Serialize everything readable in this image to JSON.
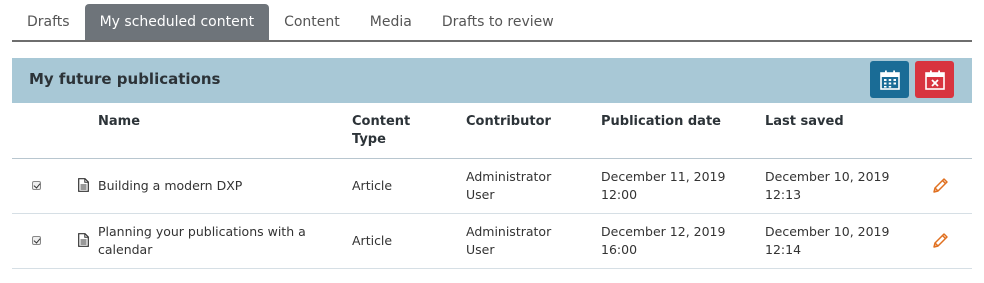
{
  "tabs": [
    {
      "label": "Drafts"
    },
    {
      "label": "My scheduled content"
    },
    {
      "label": "Content"
    },
    {
      "label": "Media"
    },
    {
      "label": "Drafts to review"
    }
  ],
  "panel": {
    "title": "My future publications",
    "calendar_icon": "calendar-icon",
    "unschedule_icon": "calendar-remove-icon",
    "colors": {
      "header_bg": "#a8c8d6",
      "calendar_btn": "#1a6c96",
      "unschedule_btn": "#d8343f",
      "edit_icon": "#e07020"
    }
  },
  "table": {
    "headers": {
      "name": "Name",
      "content_type_1": "Content",
      "content_type_2": "Type",
      "contributor": "Contributor",
      "publication_date": "Publication date",
      "last_saved": "Last saved"
    },
    "rows": [
      {
        "checked": true,
        "name_1": "Building a modern DXP",
        "name_2": "",
        "content_type": "Article",
        "contributor_1": "Administrator",
        "contributor_2": "User",
        "publication_date_1": "December 11, 2019",
        "publication_date_2": "12:00",
        "last_saved_1": "December 10, 2019",
        "last_saved_2": "12:13"
      },
      {
        "checked": true,
        "name_1": "Planning your publications with a",
        "name_2": "calendar",
        "content_type": "Article",
        "contributor_1": "Administrator",
        "contributor_2": "User",
        "publication_date_1": "December 12, 2019",
        "publication_date_2": "16:00",
        "last_saved_1": "December 10, 2019",
        "last_saved_2": "12:14"
      }
    ]
  }
}
